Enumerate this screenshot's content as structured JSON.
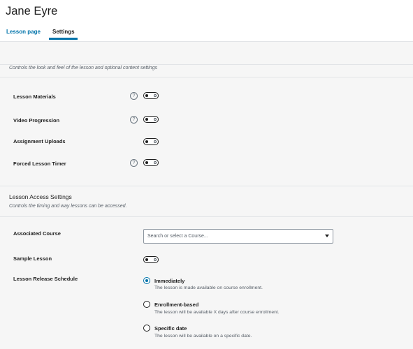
{
  "header": {
    "title": "Jane Eyre",
    "tabs": [
      {
        "label": "Lesson page",
        "active": false
      },
      {
        "label": "Settings",
        "active": true
      }
    ],
    "accent_color": "#0073aa"
  },
  "content_settings": {
    "description": "Controls the look and feel of the lesson and optional content settings",
    "rows": [
      {
        "label": "Lesson Materials",
        "has_help": true,
        "help_icon": "question-circle-icon",
        "enabled": false
      },
      {
        "label": "Video Progression",
        "has_help": true,
        "help_icon": "question-circle-icon",
        "enabled": false
      },
      {
        "label": "Assignment Uploads",
        "has_help": false,
        "enabled": false
      },
      {
        "label": "Forced Lesson Timer",
        "has_help": true,
        "help_icon": "question-circle-icon",
        "enabled": false
      }
    ]
  },
  "access_settings": {
    "title": "Lesson Access Settings",
    "description": "Controls the timing and way lessons can be accessed.",
    "associated_course": {
      "label": "Associated Course",
      "placeholder": "Search or select a Course..."
    },
    "sample_lesson": {
      "label": "Sample Lesson",
      "enabled": false
    },
    "release_schedule": {
      "label": "Lesson Release Schedule",
      "options": [
        {
          "label": "Immediately",
          "help": "The lesson is made available on course enrollment.",
          "selected": true
        },
        {
          "label": "Enrollment-based",
          "help": "The lesson will be available X days after course enrollment.",
          "selected": false
        },
        {
          "label": "Specific date",
          "help": "The lesson will be available on a specific date.",
          "selected": false
        }
      ]
    }
  },
  "help_glyph": "?"
}
